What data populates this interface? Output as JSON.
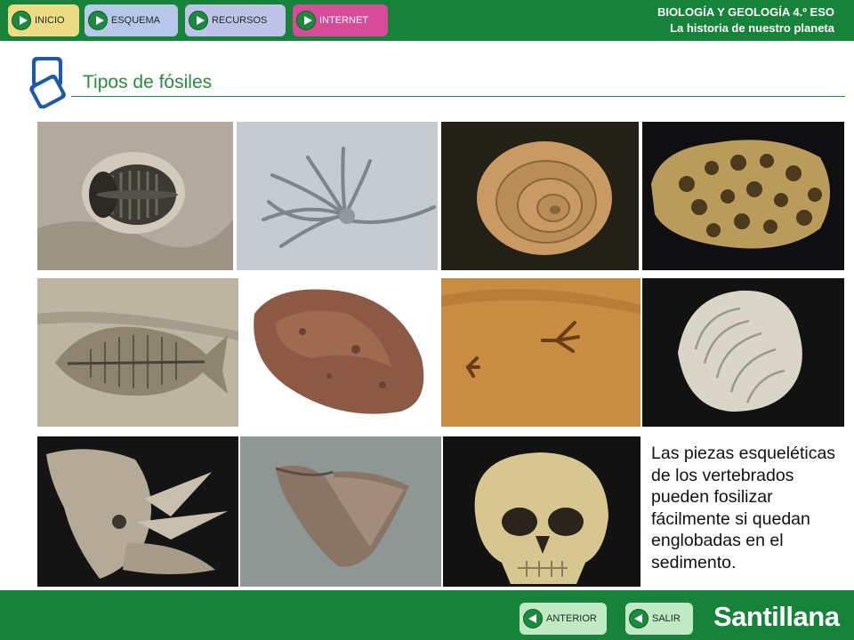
{
  "nav": {
    "inicio": "INICIO",
    "esquema": "ESQUEMA",
    "recursos": "RECURSOS",
    "internet": "INTERNET"
  },
  "header": {
    "subject": "BIOLOGÍA Y GEOLOGÍA 4.º ESO",
    "unit": "La historia de nuestro planeta"
  },
  "page": {
    "title": "Tipos de fósiles"
  },
  "fossils": [
    {
      "id": "trilobite",
      "icon": "trilobite-fossil"
    },
    {
      "id": "crinoid",
      "icon": "crinoid-fossil"
    },
    {
      "id": "ammonite",
      "icon": "ammonite-fossil"
    },
    {
      "id": "coral",
      "icon": "coral-fossil"
    },
    {
      "id": "fish",
      "icon": "fish-fossil"
    },
    {
      "id": "coprolite",
      "icon": "coprolite-fossil"
    },
    {
      "id": "footprints",
      "icon": "footprint-fossil"
    },
    {
      "id": "foraminifera",
      "icon": "foraminifera-fossil"
    },
    {
      "id": "triceratops",
      "icon": "triceratops-skull-fossil"
    },
    {
      "id": "shark-tooth",
      "icon": "shark-tooth-fossil"
    },
    {
      "id": "human-skull",
      "icon": "human-skull-fossil"
    }
  ],
  "body": {
    "text": "Las piezas esqueléticas de los vertebrados pueden fosilizar fácilmente si quedan englobadas en el sedimento."
  },
  "footer": {
    "anterior": "ANTERIOR",
    "salir": "SALIR",
    "brand": "Santillana"
  },
  "colors": {
    "brand_green": "#17823a",
    "title_green": "#2e8b3e",
    "inicio": "#eddc86",
    "esquema": "#b7c8ea",
    "recursos": "#bfc3e9",
    "internet": "#d64c9a",
    "footer_button": "#bfeac4"
  }
}
